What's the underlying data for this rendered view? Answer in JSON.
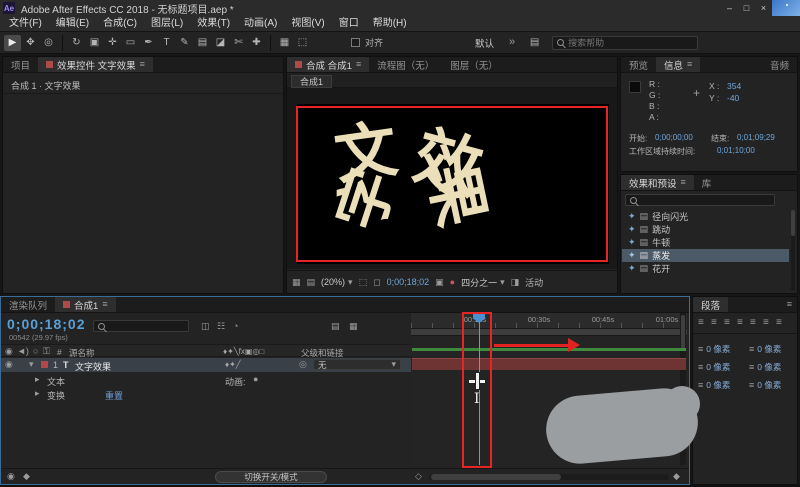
{
  "window": {
    "title": "Adobe After Effects CC 2018 - 无标题项目.aep *",
    "logo": "Ae",
    "minimize": "–",
    "maximize": "□",
    "close": "×"
  },
  "menu": {
    "items": [
      "文件(F)",
      "编辑(E)",
      "合成(C)",
      "图层(L)",
      "效果(T)",
      "动画(A)",
      "视图(V)",
      "窗口",
      "帮助(H)"
    ]
  },
  "toolbar": {
    "tools": [
      {
        "name": "selection",
        "glyph": "▶"
      },
      {
        "name": "hand",
        "glyph": "✥"
      },
      {
        "name": "zoom",
        "glyph": "◎"
      },
      {
        "name": "rotation",
        "glyph": "↻"
      },
      {
        "name": "camera",
        "glyph": "▣"
      },
      {
        "name": "pan-behind",
        "glyph": "✛"
      },
      {
        "name": "shape",
        "glyph": "▭"
      },
      {
        "name": "pen",
        "glyph": "✒"
      },
      {
        "name": "type",
        "glyph": "T"
      },
      {
        "name": "brush",
        "glyph": "✎"
      },
      {
        "name": "clone-stamp",
        "glyph": "▤"
      },
      {
        "name": "eraser",
        "glyph": "◪"
      },
      {
        "name": "roto-brush",
        "glyph": "✄"
      },
      {
        "name": "puppet",
        "glyph": "✚"
      }
    ],
    "align_label": "对齐",
    "workspace": "默认",
    "more": "»",
    "search_placeholder": "搜索帮助"
  },
  "project_panel": {
    "tab_project": "项目",
    "tab_effect_controls": "效果控件 文字效果",
    "breadcrumb": "合成 1 · 文字效果"
  },
  "comp_panel": {
    "tab_comp": "合成 合成1",
    "tab_flowchart": "流程图（无）",
    "tab_layer": "图层（无）",
    "viewer_tab": "合成1",
    "scatter": [
      {
        "ch": "文"
      },
      {
        "ch": "效"
      },
      {
        "ch": "字"
      },
      {
        "ch": "果"
      }
    ],
    "zoom": "(20%)",
    "timecode": "0;00;18;02",
    "resolution": "四分之一",
    "camera": "活动"
  },
  "info_panel": {
    "tab_preview": "预览",
    "tab_info": "信息",
    "tab_audio": "音频",
    "r": "R :",
    "g": "G :",
    "b": "B :",
    "a": "A :",
    "x_label": "X :",
    "x_value": "354",
    "y_label": "Y :",
    "y_value": "-40",
    "start_label": "开始:",
    "start_value": "0;00;00;00",
    "end_label": "结束:",
    "end_value": "0;01;09;29",
    "duration_label": "工作区域持续时间:",
    "duration_value": "0;01;10;00"
  },
  "effects_panel": {
    "tab": "效果和预设",
    "tab_library": "库",
    "items": [
      {
        "label": "径向闪光"
      },
      {
        "label": "跳动"
      },
      {
        "label": "牛顿"
      },
      {
        "label": "蒸发"
      },
      {
        "label": "花开"
      }
    ]
  },
  "timeline": {
    "tab_render_queue": "渲染队列",
    "tab_comp": "合成1",
    "timecode": "0;00;18;02",
    "frame_info": "00542 (29.97 fps)",
    "col_hash": "#",
    "col_source": "源名称",
    "col_parent": "父级和链接",
    "switch_header": "♦✦╲fx▣◎□",
    "layer": {
      "index": "1",
      "type": "T",
      "name": "文字效果",
      "switches": "♦✦╱",
      "parent": "无"
    },
    "prop": {
      "text": "文本",
      "animate": "动画:",
      "transform": "变换",
      "reset": "重置"
    },
    "ruler": [
      "00:15s",
      "00:30s",
      "00:45s",
      "01:00s"
    ],
    "toggle": "切换开关/模式"
  },
  "paragraph_panel": {
    "tab": "段落",
    "field_value": "0 像素"
  },
  "annotations": {
    "ibeam": "I"
  },
  "glyphs": {
    "hamburger": "≡",
    "chevron_down": "▾",
    "twirl_open": "▾",
    "twirl_closed": "▸",
    "double_chevron": "»",
    "eye": "◉",
    "speaker": "◄)",
    "solo": "○",
    "lock": "⚿",
    "dot": "●",
    "grid": "▦",
    "layout": "▤",
    "roi": "⬚",
    "checker": "◻",
    "camera": "▣",
    "fastpreview": "◨",
    "target": "◎",
    "diamond": "◆",
    "diamond_open": "◇",
    "align": "≡",
    "plus": "+",
    "flag": "✦",
    "preset": "▤",
    "chart": "☷",
    "motion": "◔",
    "pin": "◫"
  },
  "colors": {
    "accent_blue": "#57a0e0",
    "timecode_blue": "#58a0d8",
    "annotation_red": "#e82525",
    "comp_text": "#ebdfba",
    "layer_bar": "#6e3434",
    "work_area_green": "#3f8a3f"
  }
}
